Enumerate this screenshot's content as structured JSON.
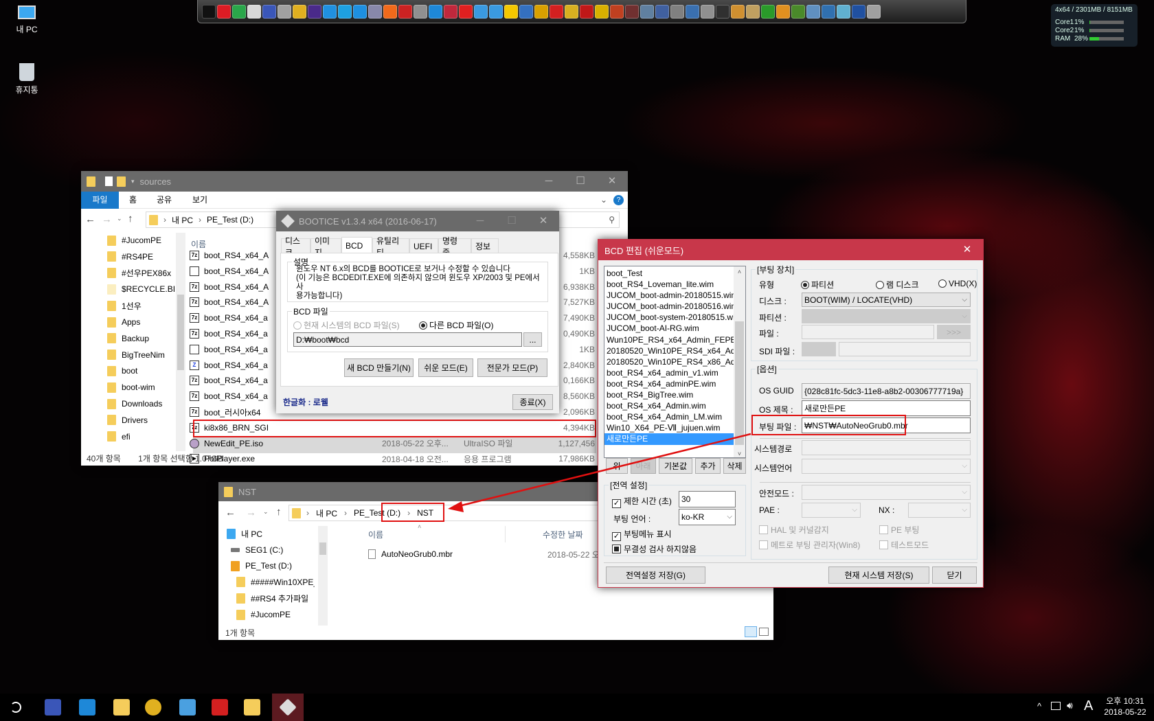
{
  "desktop": {
    "icons": [
      {
        "label": "내 PC",
        "icon": "computer-icon"
      },
      {
        "label": "휴지통",
        "icon": "recycle-bin-icon"
      }
    ]
  },
  "toolbar": {
    "icons": [
      {
        "name": "7zip-icon",
        "color": "#111111"
      },
      {
        "name": "bootice-diamond-icon",
        "color": "#dd1c24"
      },
      {
        "name": "partition-icon",
        "color": "#2aa64a"
      },
      {
        "name": "floppy-icon",
        "color": "#d8d8d8"
      },
      {
        "name": "monitor-check-icon",
        "color": "#3a56b8"
      },
      {
        "name": "drive-icon",
        "color": "#a0a0a0"
      },
      {
        "name": "chrome-icon",
        "color": "#e0b020"
      },
      {
        "name": "cpu-icon",
        "color": "#4a2a8a"
      },
      {
        "name": "display-icon",
        "color": "#2090e0"
      },
      {
        "name": "windows-icon",
        "color": "#1ea0e0"
      },
      {
        "name": "gears-icon",
        "color": "#1e90e0"
      },
      {
        "name": "computer-icon",
        "color": "#8888aa"
      },
      {
        "name": "onair-icon",
        "color": "#f26a1b"
      },
      {
        "name": "chart-icon",
        "color": "#cc2222"
      },
      {
        "name": "network-drive-icon",
        "color": "#909090"
      },
      {
        "name": "ie-icon",
        "color": "#1e88d8"
      },
      {
        "name": "registry-icon",
        "color": "#c0283c"
      },
      {
        "name": "ntpwedit-icon",
        "color": "#e02020"
      },
      {
        "name": "network-icon",
        "color": "#3a9ae0"
      },
      {
        "name": "network2-icon",
        "color": "#3a9ae0"
      },
      {
        "name": "player-icon",
        "color": "#f5c800"
      },
      {
        "name": "windows-setup-icon",
        "color": "#3470c0"
      },
      {
        "name": "key-icon",
        "color": "#d8a000"
      },
      {
        "name": "grid-app-icon",
        "color": "#d42020"
      },
      {
        "name": "cd-icon",
        "color": "#d8b020"
      },
      {
        "name": "dice-icon",
        "color": "#c01818"
      },
      {
        "name": "dots-icon",
        "color": "#d8b000"
      },
      {
        "name": "imagine-icon",
        "color": "#c04020"
      },
      {
        "name": "recovery-icon",
        "color": "#703030"
      },
      {
        "name": "hdd-tool-icon",
        "color": "#6080a0"
      },
      {
        "name": "cleaner-icon",
        "color": "#4060a0"
      },
      {
        "name": "gauge-icon",
        "color": "#808080"
      },
      {
        "name": "lan-icon",
        "color": "#3a70b0"
      },
      {
        "name": "usb-icon",
        "color": "#909090"
      },
      {
        "name": "pdf-icon",
        "color": "#303030"
      },
      {
        "name": "archive-icon",
        "color": "#d09030"
      },
      {
        "name": "disc-icon",
        "color": "#c0a060"
      },
      {
        "name": "utorrent-icon",
        "color": "#2a9a2a"
      },
      {
        "name": "pen-icon",
        "color": "#e09020"
      },
      {
        "name": "tree-icon",
        "color": "#4a8a2a"
      },
      {
        "name": "image-viewer-icon",
        "color": "#6090c0"
      },
      {
        "name": "desktop-icon",
        "color": "#3070b0"
      },
      {
        "name": "book-icon",
        "color": "#60b0d0"
      },
      {
        "name": "flag-icon",
        "color": "#2050a0"
      },
      {
        "name": "trash-icon",
        "color": "#a0a0a0"
      }
    ]
  },
  "sysmon": {
    "header": "4x64 / 2301MB / 8151MB",
    "rows": [
      {
        "label": "Core1",
        "value": "1%",
        "percent": 1
      },
      {
        "label": "Core2",
        "value": "1%",
        "percent": 1
      },
      {
        "label": "RAM",
        "value": "28%",
        "percent": 28
      }
    ]
  },
  "explorer_sources": {
    "title": "sources",
    "ribbon_tabs": [
      "파일",
      "홈",
      "공유",
      "보기"
    ],
    "breadcrumb": [
      "내 PC",
      "PE_Test (D:)"
    ],
    "nav_items": [
      "#JucomPE",
      "#RS4PE",
      "#선우PEX86x",
      "$RECYCLE.BII",
      "1선우",
      "Apps",
      "Backup",
      "BigTreeNim",
      "boot",
      "boot-wim",
      "Downloads",
      "Drivers",
      "efi"
    ],
    "column_name": "이름",
    "files": [
      {
        "name": "boot_RS4_x64_A",
        "icon": "7z",
        "size": "4,558KB"
      },
      {
        "name": "boot_RS4_x64_A",
        "icon": "txt",
        "size": "1KB"
      },
      {
        "name": "boot_RS4_x64_A",
        "icon": "7z",
        "size": "6,938KB"
      },
      {
        "name": "boot_RS4_x64_A",
        "icon": "7z",
        "size": "7,527KB"
      },
      {
        "name": "boot_RS4_x64_a",
        "icon": "7z",
        "size": "7,490KB"
      },
      {
        "name": "boot_RS4_x64_a",
        "icon": "7z",
        "size": "0,490KB"
      },
      {
        "name": "boot_RS4_x64_a",
        "icon": "txt",
        "size": "1KB"
      },
      {
        "name": "boot_RS4_x64_a",
        "icon": "z",
        "size": "2,840KB"
      },
      {
        "name": "boot_RS4_x64_a",
        "icon": "7z",
        "size": "0,166KB"
      },
      {
        "name": "boot_RS4_x64_a",
        "icon": "7z",
        "size": "8,560KB"
      },
      {
        "name": "boot_러시아x64",
        "icon": "7z",
        "size": "2,096KB"
      },
      {
        "name": "ki8x86_BRN_SGI",
        "icon": "7z",
        "size": "4,394KB"
      },
      {
        "name": "NewEdit_PE.iso",
        "icon": "iso",
        "date": "2018-05-22 오후...",
        "type": "UltraISO 파일",
        "size": "1,127,456",
        "selected": true
      },
      {
        "name": "PotPlayer.exe",
        "icon": "exe",
        "date": "2018-04-18 오전...",
        "type": "응용 프로그램",
        "size": "17,986KB"
      }
    ],
    "status_count": "40개 항목",
    "status_selected": "1개 항목 선택함 1.07GB"
  },
  "bootice": {
    "title": "BOOTICE v1.3.4 x64 (2016-06-17)",
    "tabs": [
      "디스크",
      "이미지",
      "BCD",
      "유틸리티",
      "UEFI",
      "명령 줄",
      "정보"
    ],
    "selected_tab": "BCD",
    "desc_label": "설명",
    "desc_lines": [
      "윈도우 NT 6.x의 BCD를 BOOTICE로 보거나 수정할 수 있습니다",
      "(이 기능은 BCDEDIT.EXE에 의존하지 않으며 윈도우 XP/2003 및 PE에서 사",
      "용가능합니다)"
    ],
    "bcd_file_label": "BCD 파일",
    "radio_current": "현재 시스템의 BCD 파일(S)",
    "radio_other": "다른 BCD 파일(O)",
    "path_value": "D:₩boot₩bcd",
    "browse_label": "...",
    "btn_new": "새 BCD 만들기(N)",
    "btn_easy": "쉬운 모드(E)",
    "btn_expert": "전문가 모드(P)",
    "credit": "한글화 : 로웰",
    "btn_close": "종료(X)"
  },
  "bcd_editor": {
    "title": "BCD 편집 (쉬운모드)",
    "entries": [
      "boot_Test",
      "boot_RS4_Loveman_lite.wim",
      "JUCOM_boot-admin-20180515.wim",
      "JUCOM_boot-admin-20180516.wim",
      "JUCOM_boot-system-20180515.wim",
      "JUCOM_boot-AI-RG.wim",
      "Wun10PE_RS4_x64_Admin_FEPE",
      "20180520_Win10PE_RS4_x64_Admin.",
      "20180520_Win10PE_RS4_x86_Admin.",
      "boot_RS4_x64_admin_v1.wim",
      "boot_RS4_x64_adminPE.wim",
      "boot_RS4_BigTree.wim",
      "boot_RS4_x64_Admin.wim",
      "boot_RS4_x64_Admin_LM.wim",
      "Win10_X64_PE-Ⅶ_jujuen.wim",
      "새로만든PE"
    ],
    "selected_entry": "새로만든PE",
    "list_buttons": [
      "위",
      "아래",
      "기본값",
      "추가",
      "삭제"
    ],
    "global": {
      "label": "[전역 설정]",
      "timeout_label": "제한 시간 (초)",
      "timeout_value": "30",
      "lang_label": "부팅 언어 :",
      "lang_value": "ko-KR",
      "menu_label": "부팅메뉴 표시",
      "integrity_label": "무결성 검사 하지않음"
    },
    "device": {
      "label": "[부팅 장치]",
      "type_label": "유형",
      "type_options": [
        "파티션",
        "램 디스크",
        "VHD(X)"
      ],
      "type_selected": "파티션",
      "disk_label": "디스크 :",
      "disk_value": "BOOT(WIM) / LOCATE(VHD)",
      "partition_label": "파티션 :",
      "file_label": "파일 :",
      "file_browse": ">>>",
      "sdi_label": "SDI 파일 :"
    },
    "options": {
      "label": "[옵션]",
      "guid_label": "OS GUID",
      "guid_value": "{028c81fc-5dc3-11e8-a8b2-00306777719a}",
      "os_title_label": "OS 제목 :",
      "os_title_value": "새로만든PE",
      "boot_file_label": "부팅 파일 :",
      "boot_file_value": "₩NST₩AutoNeoGrub0.mbr",
      "syspath_label": "시스템경로",
      "syslang_label": "시스템언어",
      "safemode_label": "안전모드 :",
      "pae_label": "PAE :",
      "nx_label": "NX :",
      "hal_label": "HAL 및 커널감지",
      "pe_boot_label": "PE 부팅",
      "metro_label": "메트로 부팅 관리자(Win8)",
      "testmode_label": "테스트모드"
    },
    "btn_save_global": "전역설정 저장(G)",
    "btn_save_current": "현재 시스템 저장(S)",
    "btn_close": "닫기",
    "accent": "#c8374a"
  },
  "explorer_nst": {
    "title": "NST",
    "breadcrumb": [
      "내 PC",
      "PE_Test (D:)",
      "NST"
    ],
    "nav_items": [
      {
        "label": "내 PC",
        "icon": "computer-icon"
      },
      {
        "label": "SEG1 (C:)",
        "icon": "drive-icon"
      },
      {
        "label": "PE_Test (D:)",
        "icon": "usb-drive-icon"
      },
      {
        "label": "#####Win10XPE_SET",
        "icon": "folder-icon"
      },
      {
        "label": "##RS4 추가파일",
        "icon": "folder-icon"
      },
      {
        "label": "#JucomPE",
        "icon": "folder-icon"
      }
    ],
    "col_name": "이름",
    "col_date": "수정한 날짜",
    "files": [
      {
        "name": "AutoNeoGrub0.mbr",
        "date": "2018-05-22 오"
      }
    ],
    "status": "1개 항목"
  },
  "taskbar": {
    "apps": [
      {
        "name": "search-icon",
        "color": "#000000"
      },
      {
        "name": "system-icon",
        "color": "#3a56b8"
      },
      {
        "name": "ie-icon",
        "color": "#1e88d8"
      },
      {
        "name": "file-explorer-icon",
        "color": "#f5cd5b"
      },
      {
        "name": "chrome-icon",
        "color": "#e0b020"
      },
      {
        "name": "notepad-icon",
        "color": "#4aa0e0"
      },
      {
        "name": "grid-app-icon",
        "color": "#d42020"
      },
      {
        "name": "folder-icon",
        "color": "#f5cd5b"
      },
      {
        "name": "bootice-icon",
        "color": "#dcdcdc"
      }
    ],
    "active_app": "bootice-icon",
    "ime": "A",
    "time": "오후 10:31",
    "date": "2018-05-22"
  }
}
